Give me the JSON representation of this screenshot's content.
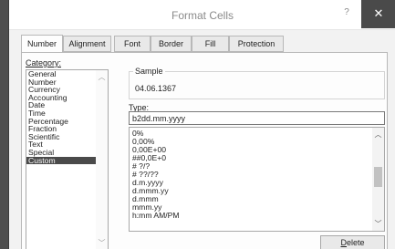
{
  "window": {
    "title": "Format Cells",
    "help_label": "?",
    "close_label": "✕"
  },
  "tabs": [
    {
      "label": "Number",
      "active": true
    },
    {
      "label": "Alignment"
    },
    {
      "label": "Font"
    },
    {
      "label": "Border"
    },
    {
      "label": "Fill"
    },
    {
      "label": "Protection"
    }
  ],
  "category": {
    "label": "Category:",
    "items": [
      "General",
      "Number",
      "Currency",
      "Accounting",
      "Date",
      "Time",
      "Percentage",
      "Fraction",
      "Scientific",
      "Text",
      "Special",
      "Custom"
    ],
    "selected": "Custom"
  },
  "sample": {
    "label": "Sample",
    "value": "04.06.1367"
  },
  "type": {
    "label": "Type:",
    "value": "b2dd.mm.yyyy"
  },
  "format_list": {
    "items": [
      "0%",
      "0,00%",
      "0,00E+00",
      "##0,0E+0",
      "# ?/?",
      "# ??/??",
      "d.m.yyyy",
      "d.mmm.yy",
      "d.mmm",
      "mmm.yy",
      "h:mm AM/PM"
    ]
  },
  "buttons": {
    "delete_label": "Delete"
  },
  "icons": {
    "scroll_up": "chevron-up-icon",
    "scroll_down": "chevron-down-icon",
    "close": "close-icon"
  },
  "colors": {
    "selected_bg": "#4a4a4a",
    "close_bg": "#4a4a4a"
  }
}
